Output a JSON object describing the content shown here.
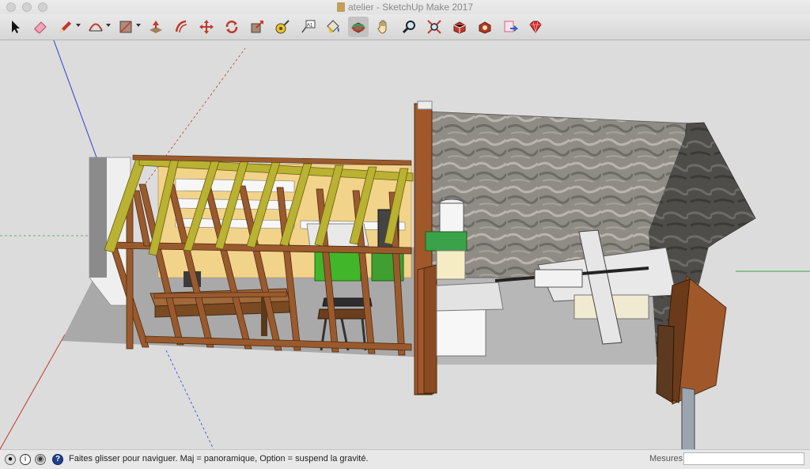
{
  "window": {
    "title": "atelier - SketchUp Make 2017"
  },
  "toolbar": {
    "tools": [
      {
        "name": "select",
        "icon": "arrow-select-icon"
      },
      {
        "name": "eraser",
        "icon": "eraser-icon"
      },
      {
        "name": "line",
        "icon": "pencil-icon",
        "dropdown": true
      },
      {
        "name": "arc",
        "icon": "arc-icon",
        "dropdown": true
      },
      {
        "name": "shapes",
        "icon": "rectangle-icon",
        "dropdown": true
      },
      {
        "name": "push-pull",
        "icon": "push-pull-icon"
      },
      {
        "name": "offset",
        "icon": "offset-icon"
      },
      {
        "name": "move",
        "icon": "move-icon"
      },
      {
        "name": "rotate",
        "icon": "rotate-icon"
      },
      {
        "name": "scale",
        "icon": "scale-icon"
      },
      {
        "name": "tape-measure",
        "icon": "tape-measure-icon"
      },
      {
        "name": "text",
        "icon": "text-icon"
      },
      {
        "name": "paint-bucket",
        "icon": "paint-bucket-icon"
      },
      {
        "name": "orbit",
        "icon": "orbit-icon",
        "active": true
      },
      {
        "name": "pan",
        "icon": "pan-hand-icon"
      },
      {
        "name": "zoom",
        "icon": "zoom-icon"
      },
      {
        "name": "zoom-extents",
        "icon": "zoom-extents-icon"
      },
      {
        "name": "3d-warehouse",
        "icon": "warehouse-icon"
      },
      {
        "name": "extension-warehouse",
        "icon": "extension-warehouse-icon"
      },
      {
        "name": "send-to-layout",
        "icon": "layout-icon"
      },
      {
        "name": "extension-manager",
        "icon": "ruby-icon"
      }
    ]
  },
  "statusbar": {
    "hint": "Faites glisser pour naviguer. Maj = panoramique, Option =  suspend la gravité.",
    "measurements_label": "Mesures",
    "measurements_value": ""
  },
  "colors": {
    "background": "#dcdcdc",
    "wood": "#9a5a2e",
    "wall_stone": "#8f8c86",
    "floor": "#a8a8a8",
    "axis_red": "#c0392b",
    "axis_green": "#3aa34a",
    "axis_blue": "#2a3fcf"
  }
}
